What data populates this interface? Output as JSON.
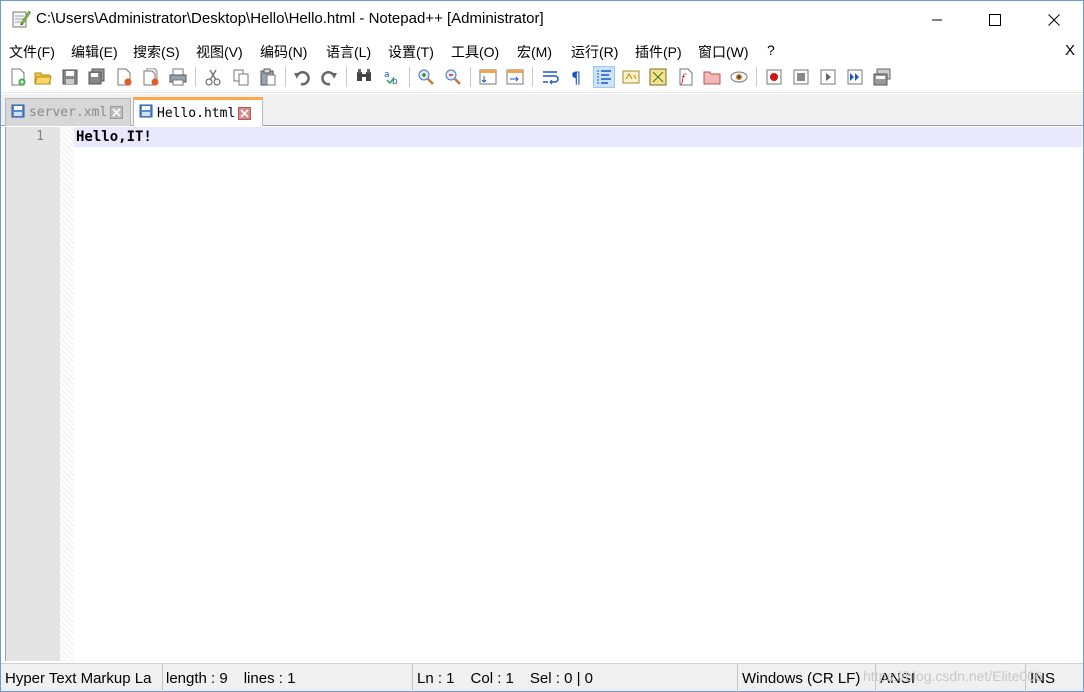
{
  "window": {
    "title": "C:\\Users\\Administrator\\Desktop\\Hello\\Hello.html - Notepad++ [Administrator]"
  },
  "menu": {
    "items": [
      "文件(F)",
      "编辑(E)",
      "搜索(S)",
      "视图(V)",
      "编码(N)",
      "语言(L)",
      "设置(T)",
      "工具(O)",
      "宏(M)",
      "运行(R)",
      "插件(P)",
      "窗口(W)",
      "?"
    ],
    "close_label": "X"
  },
  "toolbar": {
    "icons": [
      "new-file-icon",
      "open-file-icon",
      "save-icon",
      "save-all-icon",
      "close-icon",
      "close-all-icon",
      "print-icon",
      "cut-icon",
      "copy-icon",
      "paste-icon",
      "undo-icon",
      "redo-icon",
      "find-icon",
      "replace-icon",
      "zoom-in-icon",
      "zoom-out-icon",
      "sync-vertical-icon",
      "sync-horizontal-icon",
      "word-wrap-icon",
      "show-all-chars-icon",
      "indent-guide-icon",
      "user-language-icon",
      "doc-map-icon",
      "function-list-icon",
      "folder-workspace-icon",
      "monitoring-icon",
      "record-macro-icon",
      "stop-record-icon",
      "playback-macro-icon",
      "run-macro-multiple-icon",
      "save-macro-icon"
    ],
    "active_icon": "indent-guide-icon"
  },
  "tabs": [
    {
      "label": "server.xml",
      "active": false
    },
    {
      "label": "Hello.html",
      "active": true
    }
  ],
  "editor": {
    "line_numbers": [
      "1"
    ],
    "lines": [
      "Hello,IT!"
    ]
  },
  "status": {
    "language": "Hyper Text Markup La",
    "length": "length : 9",
    "lines": "lines : 1",
    "ln": "Ln : 1",
    "col": "Col : 1",
    "sel": "Sel : 0 | 0",
    "eol": "Windows (CR LF)",
    "encoding": "ANSI",
    "mode": "INS",
    "watermark": "https://blog.csdn.net/Elite006"
  }
}
